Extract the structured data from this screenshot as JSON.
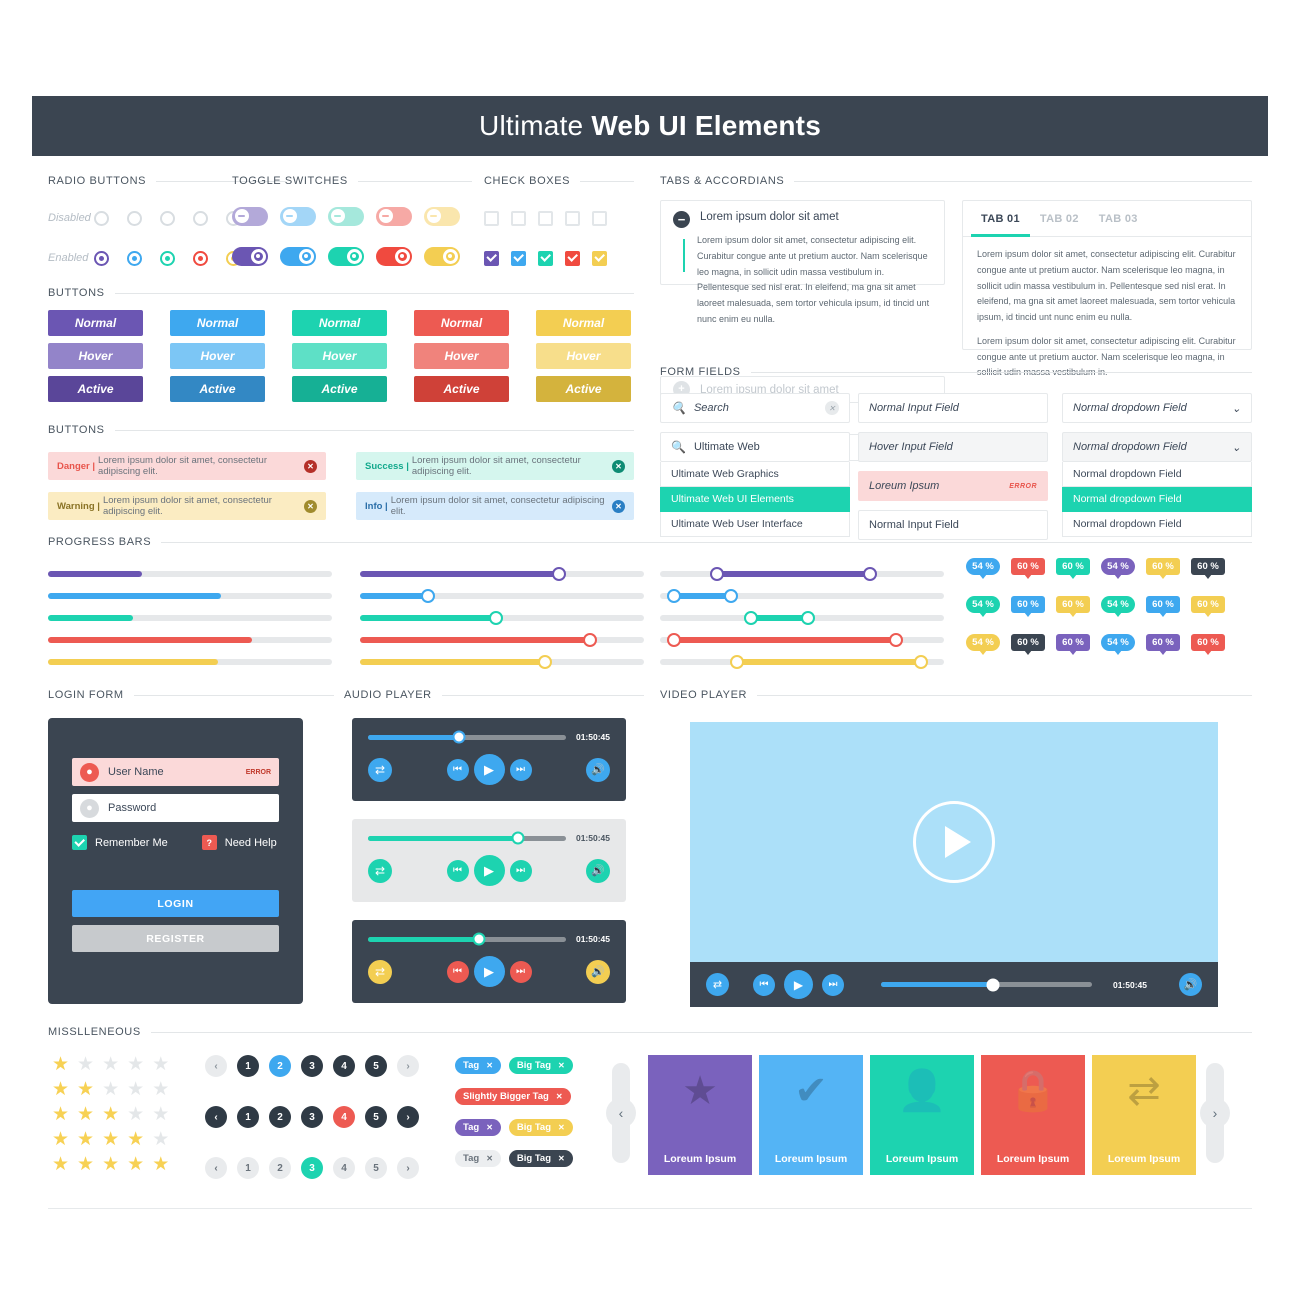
{
  "header": {
    "title_light": "Ultimate ",
    "title_bold": "Web UI Elements",
    "bg": "#3b4551"
  },
  "palette": {
    "purple": "#6b56b3",
    "blue": "#3ea8ef",
    "teal": "#1dd3b0",
    "red": "#ed5a52",
    "yellow": "#f3ce52",
    "dark": "#3b4551",
    "grey": "#c9cdd1"
  },
  "sections": {
    "radio_buttons": "RADIO BUTTONS",
    "toggle_switches": "TOGGLE SWITCHES",
    "check_boxes": "CHECK BOXES",
    "tabs_accordians": "TABS & ACCORDIANS",
    "buttons": "BUTTONS",
    "buttons2": "BUTTONS",
    "form_fields": "FORM FIELDS",
    "progress_bars": "PROGRESS BARS",
    "login_form": "LOGIN FORM",
    "audio_player": "AUDIO PLAYER",
    "video_player": "VIDEO PLAYER",
    "misc": "MISSLLENEOUS"
  },
  "state_labels": {
    "disabled": "Disabled",
    "enabled": "Enabled"
  },
  "radio_colors": [
    "#6b56b3",
    "#3ea8ef",
    "#1dd3b0",
    "#f04a3f",
    "#f3ce52"
  ],
  "toggle_off_colors": [
    "#b3a9d9",
    "#a3d6f7",
    "#a5e8dc",
    "#f6a9a5",
    "#fae6ad"
  ],
  "toggle_on_colors": [
    "#6b56b3",
    "#3ea8ef",
    "#1dd3b0",
    "#f04a3f",
    "#f3ce52"
  ],
  "checkbox_colors": [
    "#6b56b3",
    "#3ea8ef",
    "#1dd3b0",
    "#f04a3f",
    "#f3ce52"
  ],
  "buttons": {
    "states": [
      "Normal",
      "Hover",
      "Active"
    ],
    "columns": [
      {
        "name": "purple",
        "normal": "#6b56b3",
        "hover": "#9384c9",
        "active": "#5a4699"
      },
      {
        "name": "blue",
        "normal": "#3ea8ef",
        "hover": "#7cc6f5",
        "active": "#3388c4"
      },
      {
        "name": "teal",
        "normal": "#1dd3b0",
        "hover": "#5ee0c6",
        "active": "#16b095"
      },
      {
        "name": "red",
        "normal": "#ed5a52",
        "hover": "#f0837c",
        "active": "#cf4138"
      },
      {
        "name": "yellow",
        "normal": "#f3ce52",
        "hover": "#f7de8b",
        "active": "#d4b33d"
      }
    ]
  },
  "alerts": [
    {
      "label": "Danger",
      "sep": "|",
      "message": "Lorem ipsum dolor sit amet, consectetur adipiscing elit.",
      "bg": "#fbd9d9",
      "label_color": "#e8544b",
      "x_bg": "#b53029",
      "close": "✕"
    },
    {
      "label": "Success",
      "sep": "|",
      "message": "Lorem ipsum dolor sit amet, consectetur adipiscing elit.",
      "bg": "#d5f6ee",
      "label_color": "#14a98d",
      "x_bg": "#0e8c74",
      "close": "✕"
    },
    {
      "label": "Warning",
      "sep": "|",
      "message": "Lorem ipsum dolor sit amet, consectetur adipiscing elit.",
      "bg": "#fbecc2",
      "label_color": "#8a7326",
      "x_bg": "#a08b2d",
      "close": "✕"
    },
    {
      "label": "Info",
      "sep": "|",
      "message": "Lorem ipsum dolor sit amet, consectetur adipiscing elit.",
      "bg": "#d6eafb",
      "label_color": "#2b6fa8",
      "x_bg": "#2a7fc4",
      "close": "✕"
    }
  ],
  "accordion": {
    "open_title": "Lorem ipsum dolor sit amet",
    "open_body": "Lorem ipsum dolor sit amet, consectetur adipiscing elit. Curabitur congue ante ut pretium auctor. Nam scelerisque leo magna, in sollicit udin massa vestibulum in. Pellentesque sed nisl erat. In eleifend, ma gna sit amet laoreet malesuada, sem tortor vehicula ipsum, id tincid unt nunc enim eu nulla.",
    "closed_items": [
      "Lorem ipsum dolor sit amet",
      "Lorem ipsum dolor sit amet"
    ],
    "minus_icon": "−",
    "plus_icon": "+"
  },
  "tabs": {
    "items": [
      {
        "label": "TAB 01",
        "active": true
      },
      {
        "label": "TAB 02",
        "active": false
      },
      {
        "label": "TAB 03",
        "active": false
      }
    ],
    "paragraph1": "Lorem ipsum dolor sit amet, consectetur adipiscing elit. Curabitur congue ante ut pretium auctor. Nam scelerisque leo magna, in sollicit udin massa vestibulum in. Pellentesque sed nisl erat. In eleifend, ma gna sit amet laoreet malesuada, sem tortor vehicula ipsum, id tincid unt nunc enim eu nulla.",
    "paragraph2": "Lorem ipsum dolor sit amet, consectetur adipiscing elit. Curabitur congue ante ut pretium auctor. Nam scelerisque leo magna, in sollicit udin massa vestibulum in."
  },
  "form_fields": {
    "search_placeholder": "Search",
    "search_value": "Ultimate Web",
    "search_results": [
      {
        "label": "Ultimate Web Graphics",
        "selected": false
      },
      {
        "label": "Ultimate Web UI Elements",
        "selected": true
      },
      {
        "label": "Ultimate Web User Interface",
        "selected": false
      }
    ],
    "inputs": [
      {
        "label": "Normal Input Field",
        "state": "normal"
      },
      {
        "label": "Hover Input Field",
        "state": "hover"
      },
      {
        "label": "Loreum Ipsum",
        "state": "error",
        "error_tag": "ERROR"
      },
      {
        "label": "Normal Input Field",
        "state": "plain"
      }
    ],
    "dropdowns": [
      {
        "label": "Normal dropdown Field",
        "state": "normal"
      },
      {
        "label": "Normal dropdown Field",
        "state": "hover"
      }
    ],
    "dropdown_options": [
      {
        "label": "Normal dropdown Field",
        "selected": false
      },
      {
        "label": "Normal dropdown Field",
        "selected": true
      },
      {
        "label": "Normal dropdown Field",
        "selected": false
      }
    ]
  },
  "progress": {
    "bars": [
      {
        "color": "#6b56b3",
        "percent": 33
      },
      {
        "color": "#3ea8ef",
        "percent": 61
      },
      {
        "color": "#1dd3b0",
        "percent": 30
      },
      {
        "color": "#ed5a52",
        "percent": 72
      },
      {
        "color": "#f3ce52",
        "percent": 60
      }
    ],
    "sliders": [
      {
        "color": "#6b56b3",
        "percent": 70
      },
      {
        "color": "#3ea8ef",
        "percent": 24
      },
      {
        "color": "#1dd3b0",
        "percent": 48
      },
      {
        "color": "#ed5a52",
        "percent": 81
      },
      {
        "color": "#f3ce52",
        "percent": 65
      }
    ],
    "ranges": [
      {
        "color": "#6b56b3",
        "start": 20,
        "end": 74
      },
      {
        "color": "#3ea8ef",
        "start": 5,
        "end": 25
      },
      {
        "color": "#1dd3b0",
        "start": 32,
        "end": 52
      },
      {
        "color": "#ed5a52",
        "start": 5,
        "end": 83
      },
      {
        "color": "#f3ce52",
        "start": 27,
        "end": 92
      }
    ]
  },
  "tooltips": [
    [
      {
        "text": "54 %",
        "bg": "#3ea8ef",
        "shape": "round"
      },
      {
        "text": "60 %",
        "bg": "#ed5a52",
        "shape": "rect"
      },
      {
        "text": "60 %",
        "bg": "#1dd3b0",
        "shape": "rect"
      },
      {
        "text": "54 %",
        "bg": "#7a62bd",
        "shape": "round"
      },
      {
        "text": "60 %",
        "bg": "#f3ce52",
        "shape": "rect"
      },
      {
        "text": "60 %",
        "bg": "#3b4551",
        "shape": "rect"
      }
    ],
    [
      {
        "text": "54 %",
        "bg": "#1dd3b0",
        "shape": "round"
      },
      {
        "text": "60 %",
        "bg": "#3ea8ef",
        "shape": "rect"
      },
      {
        "text": "60 %",
        "bg": "#f3ce52",
        "shape": "rect"
      },
      {
        "text": "54 %",
        "bg": "#1dd3b0",
        "shape": "round"
      },
      {
        "text": "60 %",
        "bg": "#3ea8ef",
        "shape": "rect"
      },
      {
        "text": "60 %",
        "bg": "#f3ce52",
        "shape": "rect"
      }
    ],
    [
      {
        "text": "54 %",
        "bg": "#f3ce52",
        "shape": "round"
      },
      {
        "text": "60 %",
        "bg": "#3b4551",
        "shape": "rect"
      },
      {
        "text": "60 %",
        "bg": "#7a62bd",
        "shape": "rect"
      },
      {
        "text": "54 %",
        "bg": "#3ea8ef",
        "shape": "round"
      },
      {
        "text": "60 %",
        "bg": "#7a62bd",
        "shape": "rect"
      },
      {
        "text": "60 %",
        "bg": "#ed5a52",
        "shape": "rect"
      }
    ]
  ],
  "login": {
    "username_value": "User Name",
    "username_error": "ERROR",
    "password_value": "Password",
    "remember_label": "Remember Me",
    "help_label": "Need Help",
    "help_icon": "?",
    "login_button": "LOGIN",
    "register_button": "REGISTER",
    "user_icon": "👤",
    "lock_icon": "🔒"
  },
  "audio_players": [
    {
      "bg": "#3b4551",
      "time": "01:50:45",
      "progress": 46,
      "bar_color": "#3ea8ef",
      "shuffle_color": "#3ea8ef",
      "prev_color": "#3ea8ef",
      "play_color": "#3ea8ef",
      "next_color": "#3ea8ef",
      "volume_color": "#3ea8ef"
    },
    {
      "bg": "#e7e8e9",
      "time": "01:50:45",
      "progress": 76,
      "bar_color": "#1dd3b0",
      "shuffle_color": "#1dd3b0",
      "prev_color": "#1dd3b0",
      "play_color": "#1dd3b0",
      "next_color": "#1dd3b0",
      "volume_color": "#1dd3b0"
    },
    {
      "bg": "#3b4551",
      "time": "01:50:45",
      "progress": 56,
      "bar_color": "#1dd3b0",
      "shuffle_color": "#f3ce52",
      "prev_color": "#ed5a52",
      "play_color": "#3ea8ef",
      "next_color": "#ed5a52",
      "volume_color": "#f3ce52"
    }
  ],
  "player_icons": {
    "shuffle": "⇄",
    "prev": "⏮",
    "play": "▶",
    "next": "⏭",
    "volume": "🔊"
  },
  "video_player": {
    "screen_color": "#ace0f9",
    "bar_bg": "#3b4551",
    "time": "01:50:45",
    "progress": 53,
    "accent": "#3ea8ef"
  },
  "misc": {
    "ratings": [
      1,
      2,
      3,
      4,
      5
    ],
    "star_filled_color": "#f7d154",
    "star_empty_color": "#e4e7e9",
    "star_glyph": "★",
    "pagination": [
      {
        "style": "light-arrows",
        "prev": "‹",
        "next": "›",
        "pages": [
          {
            "n": "1",
            "bg": "#2f3a45",
            "fg": "#ffffff"
          },
          {
            "n": "2",
            "bg": "#3ea8ef",
            "fg": "#ffffff"
          },
          {
            "n": "3",
            "bg": "#2f3a45",
            "fg": "#ffffff"
          },
          {
            "n": "4",
            "bg": "#2f3a45",
            "fg": "#ffffff"
          },
          {
            "n": "5",
            "bg": "#2f3a45",
            "fg": "#ffffff"
          }
        ],
        "arrow_bg": "#e9ebed",
        "arrow_fg": "#8c959d"
      },
      {
        "style": "dark-arrows",
        "prev": "‹",
        "next": "›",
        "pages": [
          {
            "n": "1",
            "bg": "#2f3a45",
            "fg": "#ffffff"
          },
          {
            "n": "2",
            "bg": "#2f3a45",
            "fg": "#ffffff"
          },
          {
            "n": "3",
            "bg": "#2f3a45",
            "fg": "#ffffff"
          },
          {
            "n": "4",
            "bg": "#ed5a52",
            "fg": "#ffffff"
          },
          {
            "n": "5",
            "bg": "#2f3a45",
            "fg": "#ffffff"
          }
        ],
        "arrow_bg": "#2f3a45",
        "arrow_fg": "#ffffff"
      },
      {
        "style": "grey",
        "prev": "‹",
        "next": "›",
        "pages": [
          {
            "n": "1",
            "bg": "#e9ebed",
            "fg": "#6a737c"
          },
          {
            "n": "2",
            "bg": "#e9ebed",
            "fg": "#6a737c"
          },
          {
            "n": "3",
            "bg": "#1dd3b0",
            "fg": "#ffffff"
          },
          {
            "n": "4",
            "bg": "#e9ebed",
            "fg": "#6a737c"
          },
          {
            "n": "5",
            "bg": "#e9ebed",
            "fg": "#6a737c"
          }
        ],
        "arrow_bg": "#e9ebed",
        "arrow_fg": "#6a737c"
      }
    ],
    "tag_close": "✕",
    "tags": [
      [
        {
          "label": "Tag",
          "bg": "#3ea8ef",
          "fg": "#ffffff"
        },
        {
          "label": "Big Tag",
          "bg": "#1dd3b0",
          "fg": "#ffffff"
        }
      ],
      [
        {
          "label": "Slightly Bigger Tag",
          "bg": "#ed5a52",
          "fg": "#ffffff"
        }
      ],
      [
        {
          "label": "Tag",
          "bg": "#7a62bd",
          "fg": "#ffffff"
        },
        {
          "label": "Big Tag",
          "bg": "#f3ce52",
          "fg": "#ffffff"
        }
      ],
      [
        {
          "label": "Tag",
          "bg": "#eceef0",
          "fg": "#6a737c"
        },
        {
          "label": "Big Tag",
          "bg": "#3b4551",
          "fg": "#ffffff"
        }
      ]
    ],
    "carousel": {
      "prev": "‹",
      "next": "›",
      "cards": [
        {
          "label": "Loreum Ipsum",
          "bg": "#7a62bd",
          "icon": "★",
          "icon_name": "star-icon"
        },
        {
          "label": "Loreum Ipsum",
          "bg": "#54b4f5",
          "icon": "✔",
          "icon_name": "check-icon"
        },
        {
          "label": "Loreum Ipsum",
          "bg": "#1dd3b0",
          "icon": "👤",
          "icon_name": "user-icon"
        },
        {
          "label": "Loreum Ipsum",
          "bg": "#ed5a52",
          "icon": "🔒",
          "icon_name": "lock-icon"
        },
        {
          "label": "Loreum Ipsum",
          "bg": "#f3ce52",
          "icon": "⇄",
          "icon_name": "shuffle-icon"
        }
      ]
    }
  }
}
